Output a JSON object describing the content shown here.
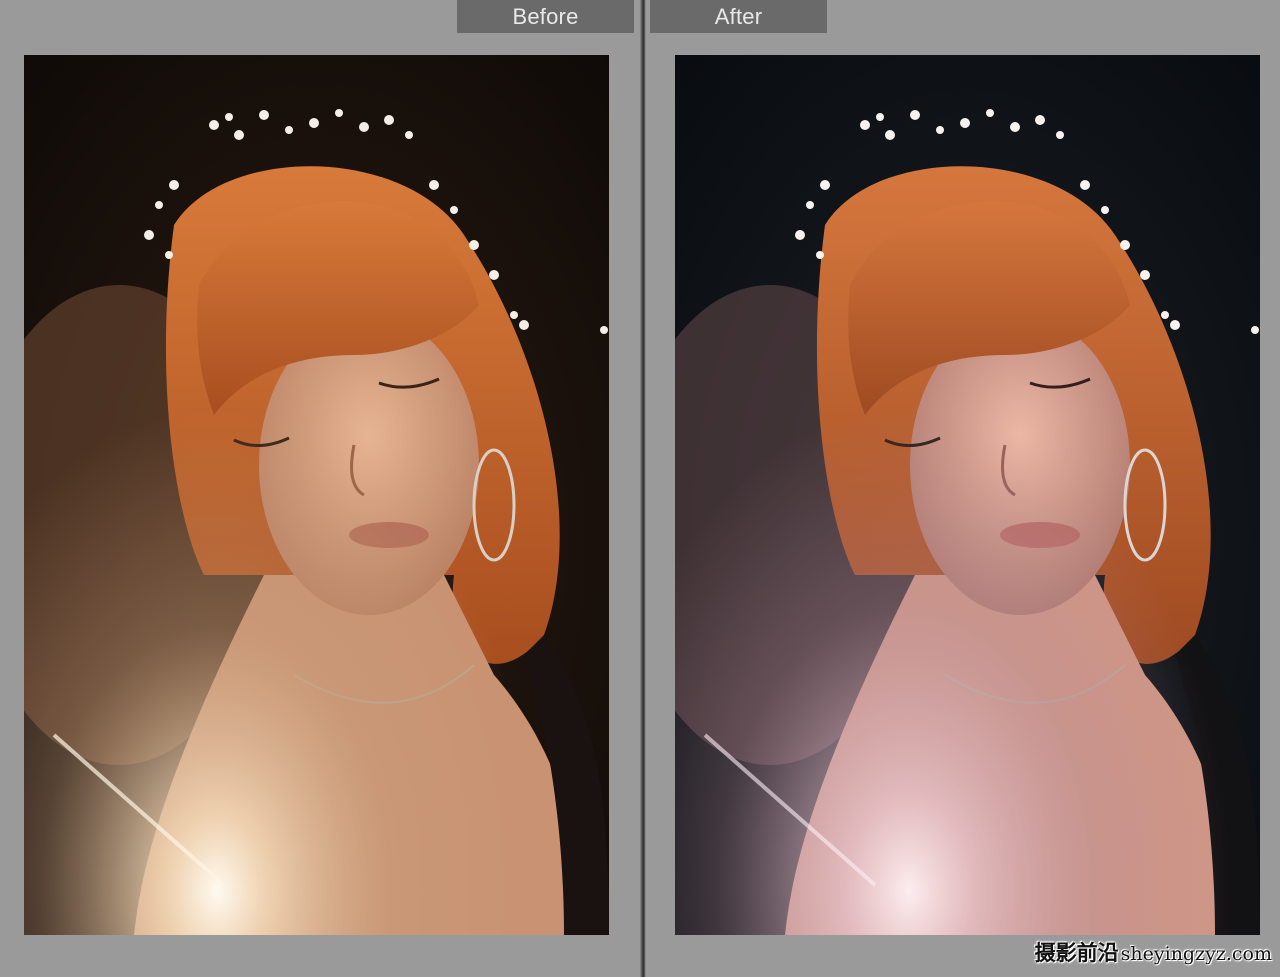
{
  "compare_view": {
    "before_label": "Before",
    "after_label": "After"
  },
  "photo": {
    "subject": "portrait",
    "before_tone": "warm",
    "after_tone": "cool"
  },
  "colors": {
    "background": "#9a9a9a",
    "label_bg": "#6a6a6a",
    "label_text": "#e9e9e9",
    "hair": "#c4652a",
    "skin_before": "#d9a07c",
    "skin_after": "#e2a590"
  },
  "watermark": {
    "cn_text": "摄影前沿",
    "site_text": "sheyingzyz.com"
  }
}
